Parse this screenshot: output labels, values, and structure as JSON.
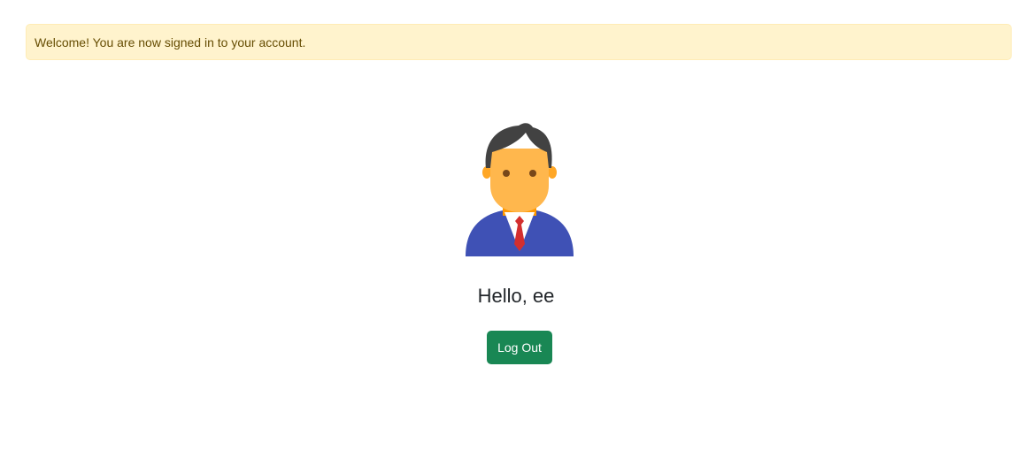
{
  "alert": {
    "message": "Welcome! You are now signed in to your account."
  },
  "profile": {
    "avatar_icon": "businessman-avatar-icon",
    "greeting": "Hello, ee"
  },
  "actions": {
    "logout_label": "Log Out"
  },
  "colors": {
    "alert_background": "#fff3cd",
    "alert_text": "#664d03",
    "button_background": "#198754",
    "avatar_skin": "#ffb74d",
    "avatar_hair": "#424242",
    "avatar_suit": "#3f51b5",
    "avatar_tie": "#d32f2f"
  }
}
